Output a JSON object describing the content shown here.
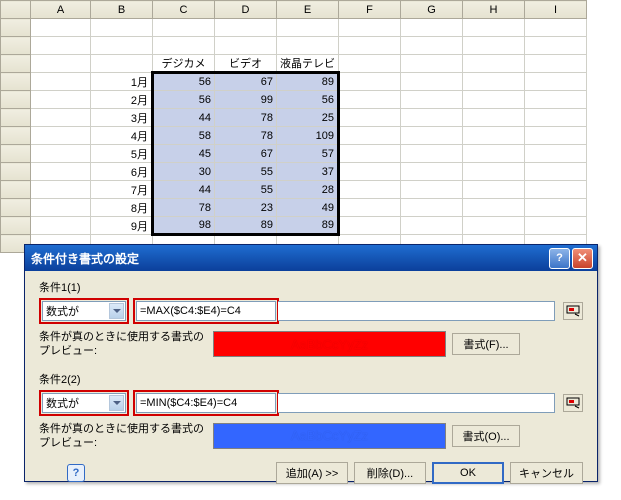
{
  "columns": [
    "A",
    "B",
    "C",
    "D",
    "E",
    "F",
    "G",
    "H",
    "I"
  ],
  "headers": {
    "c": "デジカメ",
    "d": "ビデオ",
    "e": "液晶テレビ"
  },
  "rows": [
    {
      "label": "1月",
      "c": 56,
      "d": 67,
      "e": 89
    },
    {
      "label": "2月",
      "c": 56,
      "d": 99,
      "e": 56
    },
    {
      "label": "3月",
      "c": 44,
      "d": 78,
      "e": 25
    },
    {
      "label": "4月",
      "c": 58,
      "d": 78,
      "e": 109
    },
    {
      "label": "5月",
      "c": 45,
      "d": 67,
      "e": 57
    },
    {
      "label": "6月",
      "c": 30,
      "d": 55,
      "e": 37
    },
    {
      "label": "7月",
      "c": 44,
      "d": 55,
      "e": 28
    },
    {
      "label": "8月",
      "c": 78,
      "d": 23,
      "e": 49
    },
    {
      "label": "9月",
      "c": 98,
      "d": 89,
      "e": 89
    }
  ],
  "dialog": {
    "title": "条件付き書式の設定",
    "cond1": {
      "label": "条件1(1)",
      "type": "数式が",
      "formula": "=MAX($C4:$E4)=C4",
      "previewLabel": "条件が真のときに使用する書式のプレビュー:",
      "previewText": "AaBbCcYyZz",
      "formatBtn": "書式(F)..."
    },
    "cond2": {
      "label": "条件2(2)",
      "type": "数式が",
      "formula": "=MIN($C4:$E4)=C4",
      "previewLabel": "条件が真のときに使用する書式のプレビュー:",
      "previewText": "AaBbCcYyZz",
      "formatBtn": "書式(O)..."
    },
    "buttons": {
      "add": "追加(A) >>",
      "delete": "削除(D)...",
      "ok": "OK",
      "cancel": "キャンセル"
    }
  }
}
